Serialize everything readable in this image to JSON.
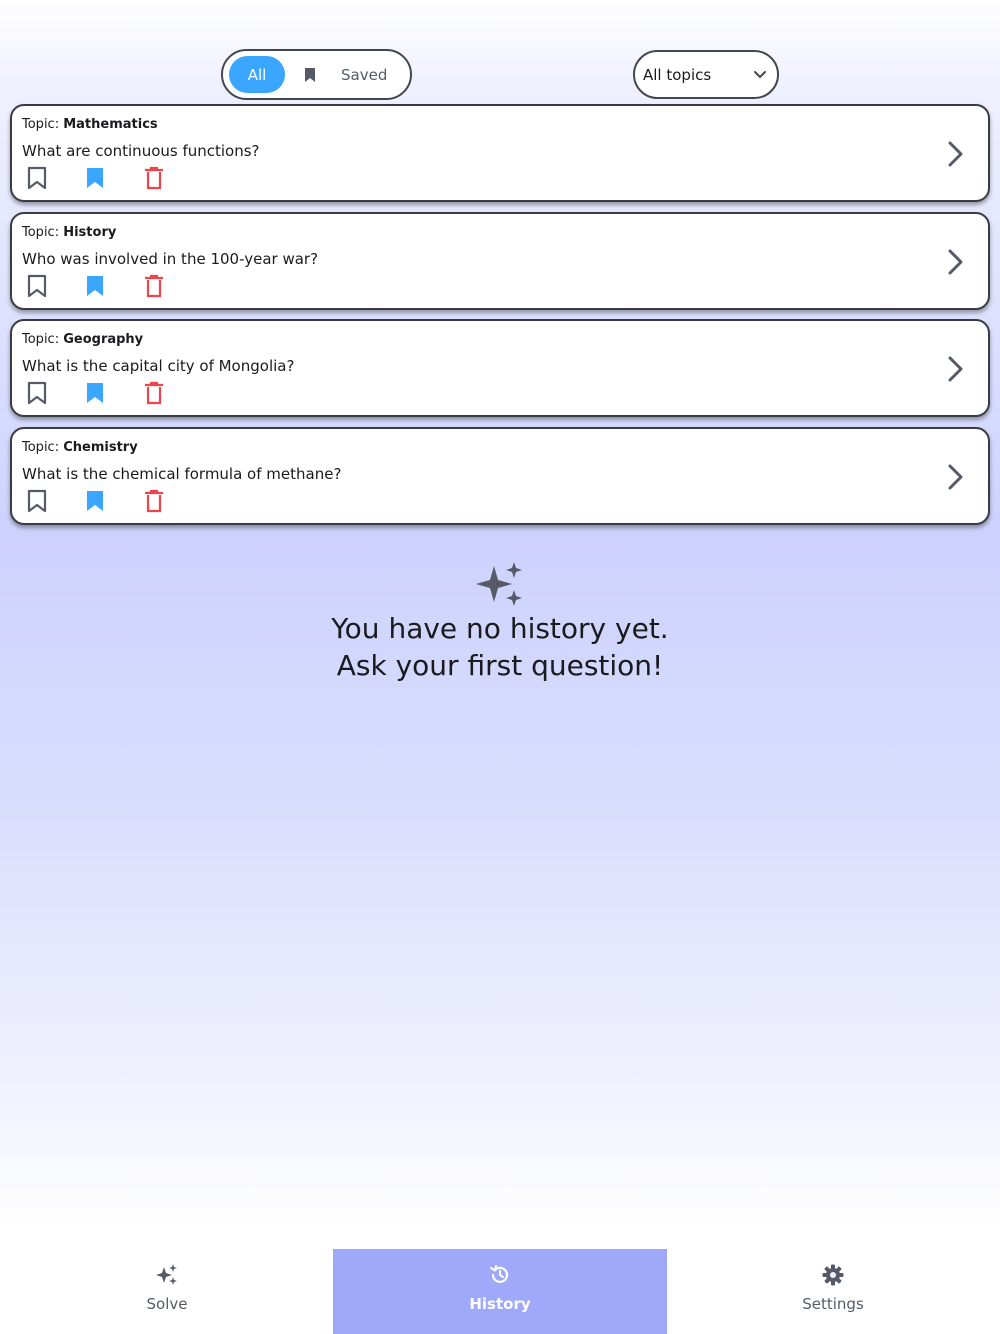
{
  "filter": {
    "all_label": "All",
    "saved_label": "Saved"
  },
  "topic_select": {
    "value": "All topics"
  },
  "topic_prefix": "Topic:",
  "items": [
    {
      "topic": "Mathematics",
      "question": "What are continuous functions?"
    },
    {
      "topic": "History",
      "question": "Who was involved in the 100-year war?"
    },
    {
      "topic": "Geography",
      "question": "What is the capital city of Mongolia?"
    },
    {
      "topic": "Chemistry",
      "question": "What is the chemical formula of methane?"
    }
  ],
  "empty": {
    "line1": "You have no history yet.",
    "line2": "Ask your first question!"
  },
  "nav": {
    "solve": "Solve",
    "history": "History",
    "settings": "Settings"
  },
  "colors": {
    "accent": "#3aa6ff",
    "delete": "#f0444c",
    "nav_active": "#9fa9f9"
  }
}
